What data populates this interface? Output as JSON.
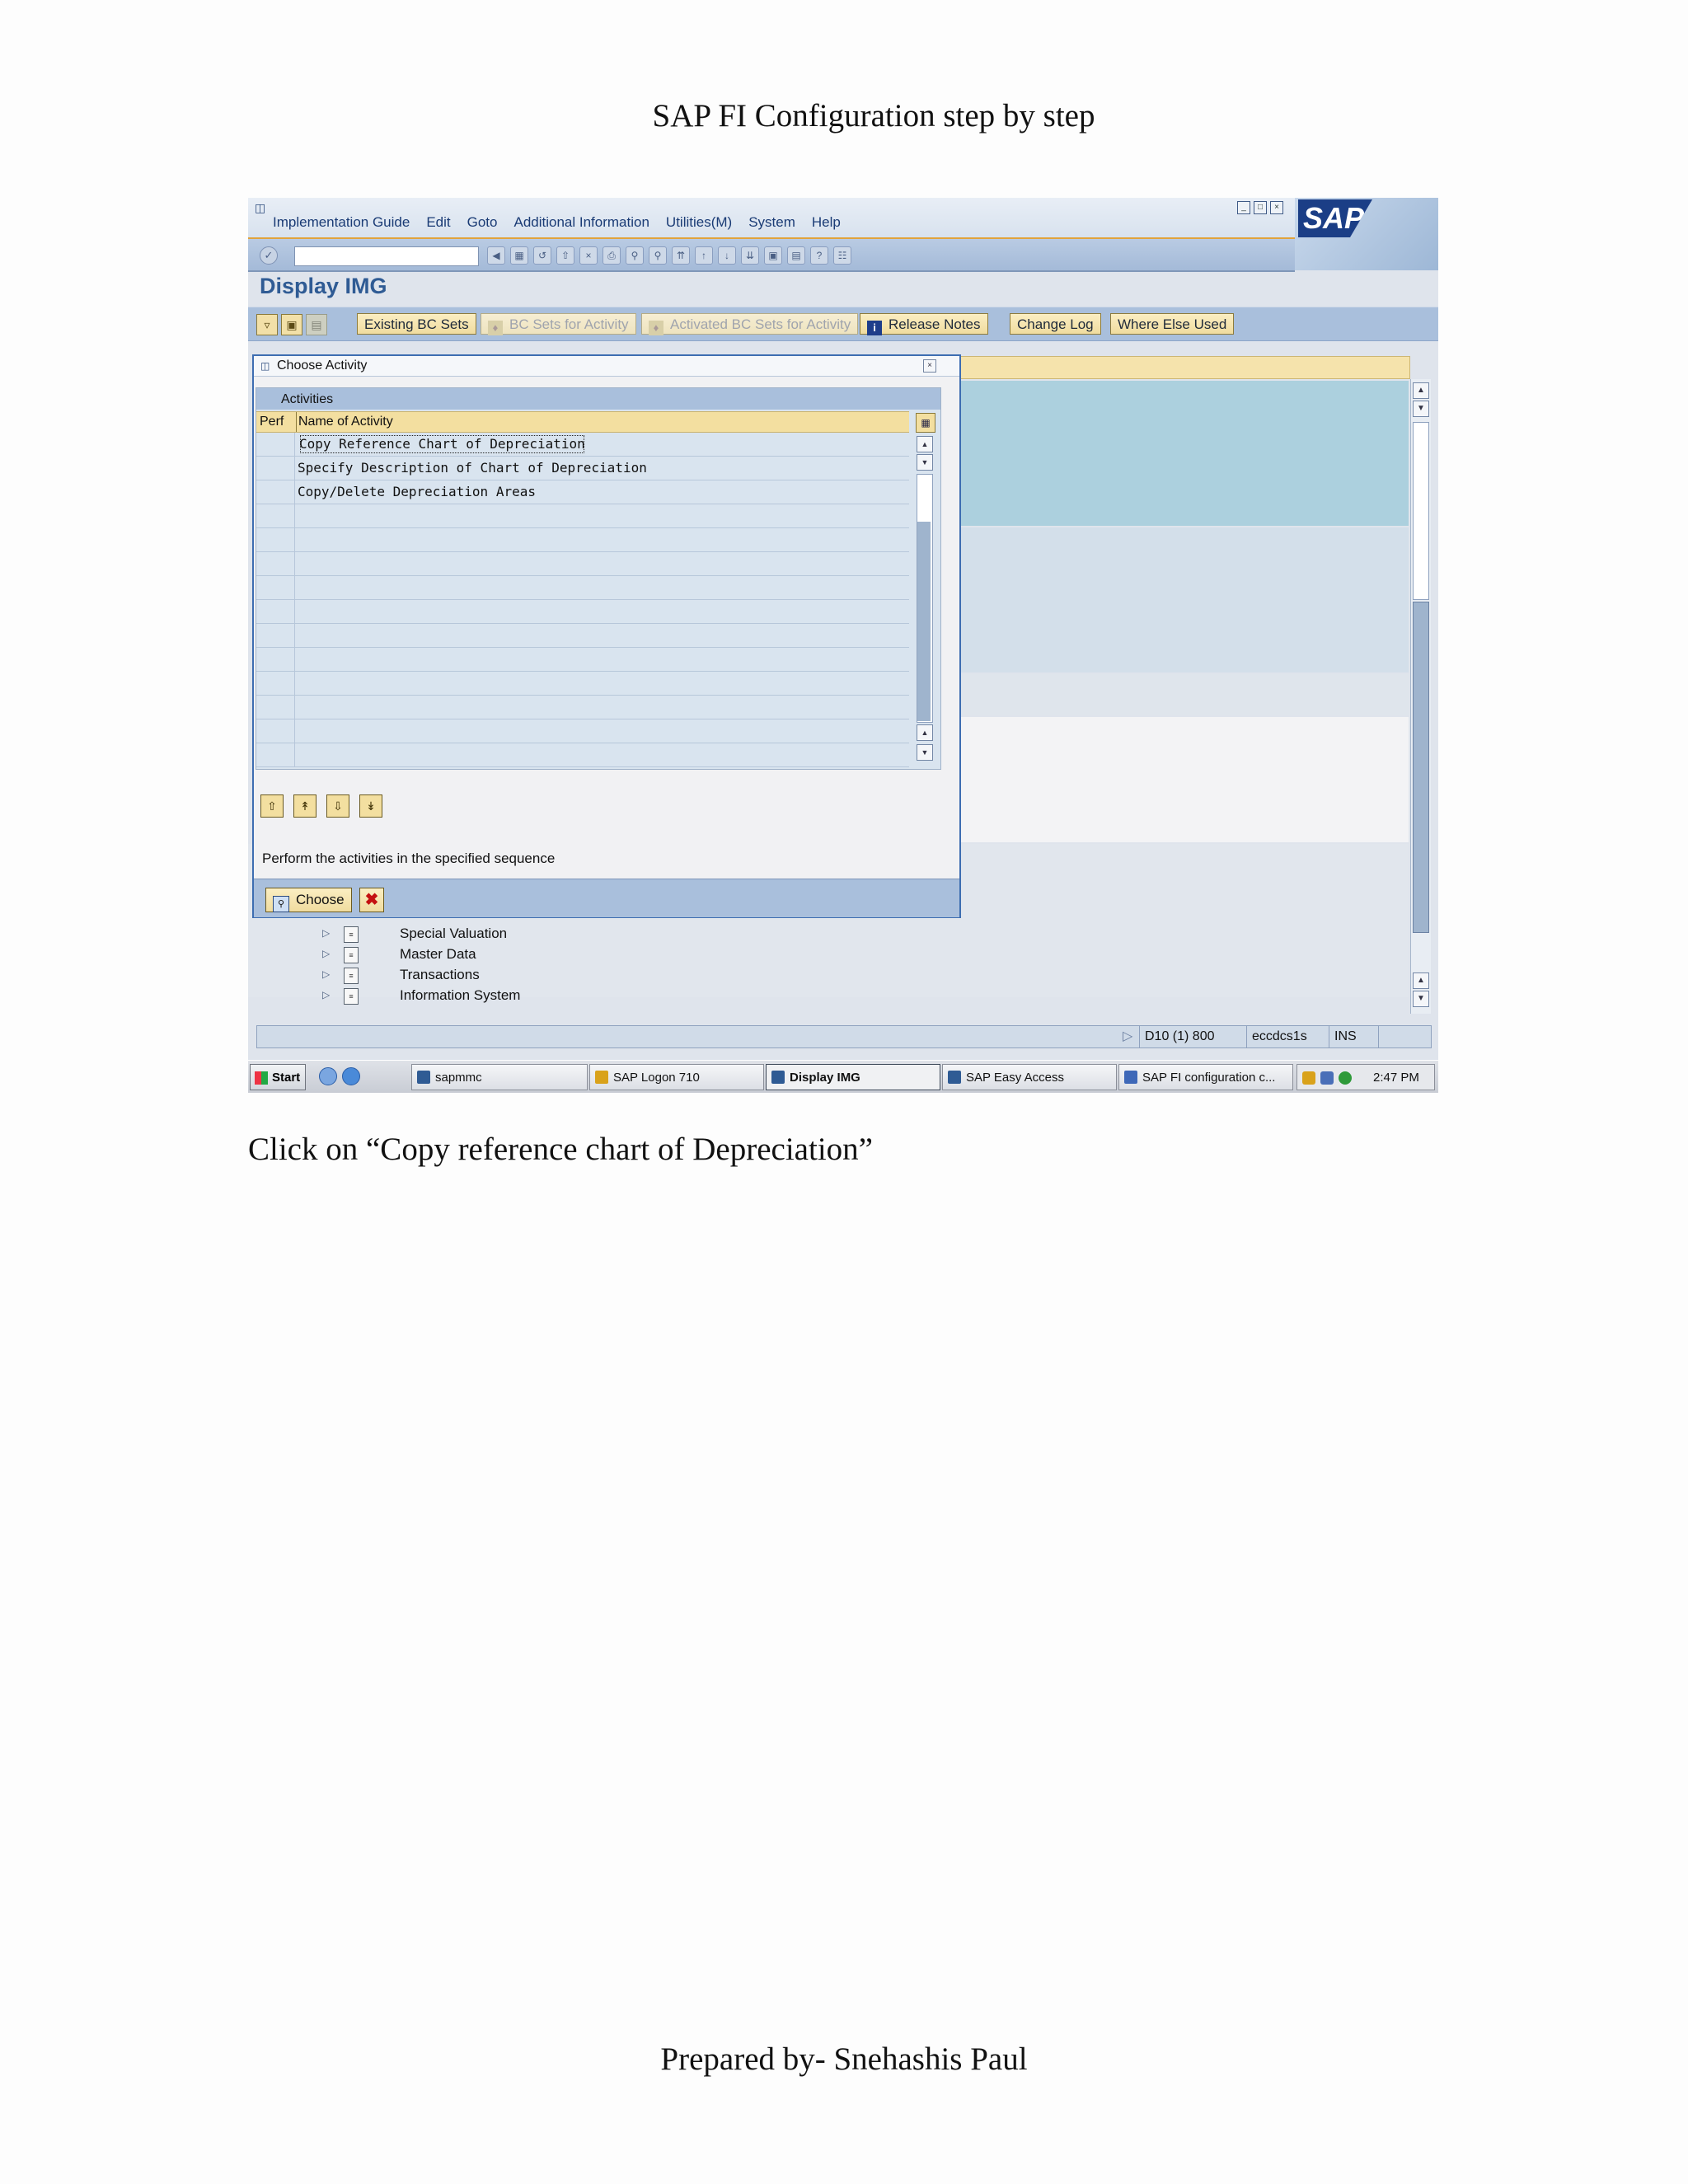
{
  "document": {
    "title": "SAP FI Configuration step by step",
    "caption": "Click on “Copy reference chart of Depreciation”",
    "footer": "Prepared by- Snehashis Paul"
  },
  "sap_window": {
    "menu": [
      "Implementation Guide",
      "Edit",
      "Goto",
      "Additional Information",
      "Utilities(M)",
      "System",
      "Help"
    ],
    "screen_title": "Display IMG",
    "app_buttons": {
      "existing_bc_sets": "Existing BC Sets",
      "bc_sets_for_activity": "BC Sets for Activity",
      "activated_bc_sets": "Activated BC Sets for Activity",
      "release_notes": "Release Notes",
      "change_log": "Change Log",
      "where_else_used": "Where Else Used"
    },
    "tree": [
      {
        "label": "Special Valuation"
      },
      {
        "label": "Master Data"
      },
      {
        "label": "Transactions"
      },
      {
        "label": "Information System"
      }
    ],
    "status": {
      "system": "D10 (1) 800",
      "server": "eccdcs1s",
      "mode": "INS"
    }
  },
  "dialog": {
    "title": "Choose Activity",
    "panel_title": "Activities",
    "col_perf": "Perf",
    "col_name": "Name of Activity",
    "activities": [
      "Copy Reference Chart of Depreciation",
      "Specify Description of Chart of Depreciation",
      "Copy/Delete Depreciation Areas"
    ],
    "hint": "Perform the activities in the specified sequence",
    "choose_label": "Choose"
  },
  "taskbar": {
    "start": "Start",
    "tasks": [
      "sapmmc",
      "SAP Logon 710",
      "Display IMG",
      "SAP Easy Access",
      "SAP FI configuration c..."
    ],
    "clock": "2:47 PM"
  },
  "colors": {
    "accent_blue": "#2f5b94",
    "button_yellow": "#f3dfa0",
    "toolbar_blue": "#a9bfdc"
  }
}
